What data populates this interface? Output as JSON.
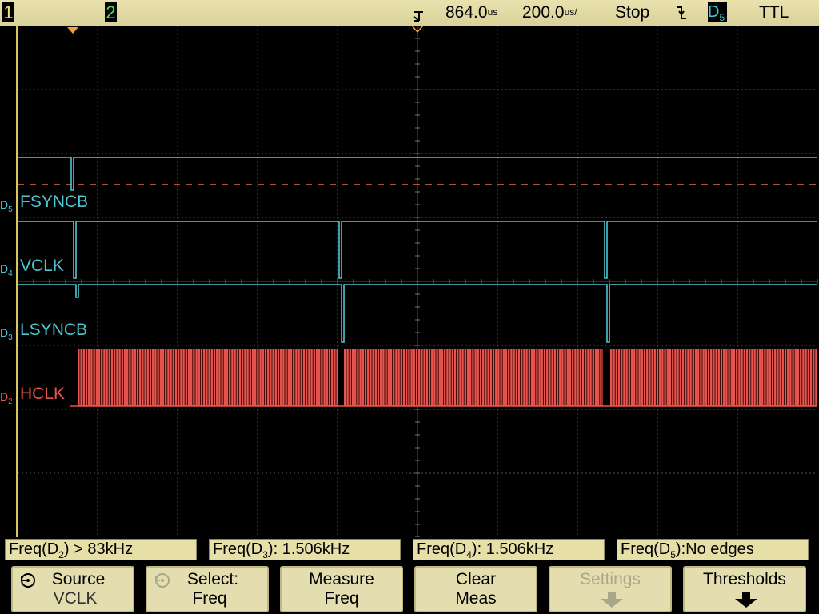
{
  "topbar": {
    "ch1": "1",
    "ch2": "2",
    "delay": "864.0",
    "delay_unit": "us",
    "timebase": "200.0",
    "timebase_unit": "us/",
    "run_state": "Stop",
    "trigger_source": "D",
    "trigger_source_sub": "5",
    "logic_threshold": "TTL"
  },
  "channels": [
    {
      "prefix": "D",
      "sub": "5",
      "name": "FSYNCB",
      "color": "#4cc7d4"
    },
    {
      "prefix": "D",
      "sub": "4",
      "name": "VCLK",
      "color": "#4cc7d4"
    },
    {
      "prefix": "D",
      "sub": "3",
      "name": "LSYNCB",
      "color": "#4cc7d4"
    },
    {
      "prefix": "D",
      "sub": "2",
      "name": "HCLK",
      "color": "#e8554e"
    }
  ],
  "measurements": [
    {
      "pre": "Freq(D",
      "sub": "2",
      "post": ") > 83kHz"
    },
    {
      "pre": "Freq(D",
      "sub": "3",
      "post": "): 1.506kHz"
    },
    {
      "pre": "Freq(D",
      "sub": "4",
      "post": "): 1.506kHz"
    },
    {
      "pre": "Freq(D",
      "sub": "5",
      "post": "):No edges"
    }
  ],
  "softkeys": [
    {
      "line1": "Source",
      "line2": "VCLK",
      "icon": "rotate-knob-icon",
      "enabled": true
    },
    {
      "line1": "Select:",
      "line2": "Freq",
      "icon": "rotate-knob-icon",
      "enabled": false
    },
    {
      "line1": "Measure",
      "line2": "Freq",
      "enabled": true
    },
    {
      "line1": "Clear",
      "line2": "Meas",
      "enabled": true
    },
    {
      "line1": "Settings",
      "line2": "",
      "icon": "down-arrow-icon",
      "enabled": false
    },
    {
      "line1": "Thresholds",
      "line2": "",
      "icon": "down-arrow-icon",
      "enabled": true
    }
  ],
  "colors": {
    "digital_trace": "#4cc7d4",
    "hclk_trace": "#e8554e",
    "trigger_marker": "#f0a040",
    "grid": "#5a5a5a",
    "bar_background": "#e6dfa7"
  }
}
